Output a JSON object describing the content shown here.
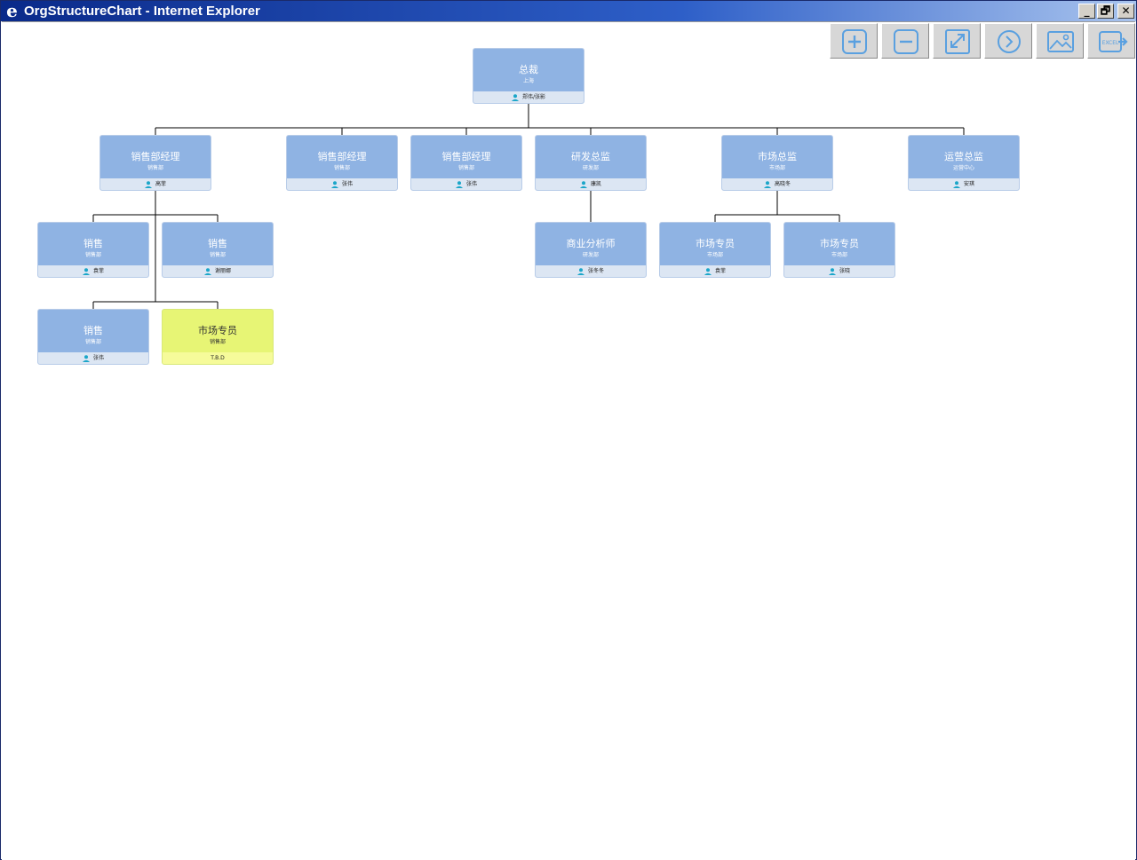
{
  "window": {
    "title": "OrgStructureChart - Internet Explorer",
    "minimize": "_",
    "restore": "🗗",
    "close": "✕"
  },
  "toolbar": {
    "buttons": [
      {
        "icon": "zoom-in-icon"
      },
      {
        "icon": "zoom-out-icon"
      },
      {
        "icon": "fit-screen-icon"
      },
      {
        "icon": "next-icon"
      },
      {
        "icon": "image-export-icon"
      },
      {
        "icon": "excel-export-icon",
        "label": "EXCEL"
      }
    ]
  },
  "colors": {
    "node": "#8fb3e3",
    "node_footer": "#dce6f3",
    "vacant": "#e7f575",
    "icon": "#1ba6c9",
    "toolbar_icon": "#5aa0e0"
  },
  "org": {
    "nodes": [
      {
        "id": "n0",
        "title": "总裁",
        "dept": "上海",
        "name": "郑伟/张影"
      },
      {
        "id": "n1",
        "title": "销售部经理",
        "dept": "销售部",
        "name": "高菲"
      },
      {
        "id": "n2",
        "title": "销售部经理",
        "dept": "销售部",
        "name": "张伟"
      },
      {
        "id": "n3",
        "title": "销售部经理",
        "dept": "销售部",
        "name": "张伟"
      },
      {
        "id": "n4",
        "title": "研发总监",
        "dept": "研发部",
        "name": "康凯"
      },
      {
        "id": "n5",
        "title": "市场总监",
        "dept": "市场部",
        "name": "高晓冬"
      },
      {
        "id": "n6",
        "title": "运营总监",
        "dept": "运营中心",
        "name": "安琪"
      },
      {
        "id": "n7",
        "title": "销售",
        "dept": "销售部",
        "name": "袁菲"
      },
      {
        "id": "n8",
        "title": "销售",
        "dept": "销售部",
        "name": "谢丽娜"
      },
      {
        "id": "n9",
        "title": "商业分析师",
        "dept": "研发部",
        "name": "张冬冬"
      },
      {
        "id": "n10",
        "title": "市场专员",
        "dept": "市场部",
        "name": "袁菲"
      },
      {
        "id": "n11",
        "title": "市场专员",
        "dept": "市场部",
        "name": "张晓"
      },
      {
        "id": "n12",
        "title": "销售",
        "dept": "销售部",
        "name": "张伟"
      },
      {
        "id": "n13",
        "title": "市场专员",
        "dept": "销售部",
        "name": "T.B.D",
        "vacant": true
      }
    ]
  }
}
